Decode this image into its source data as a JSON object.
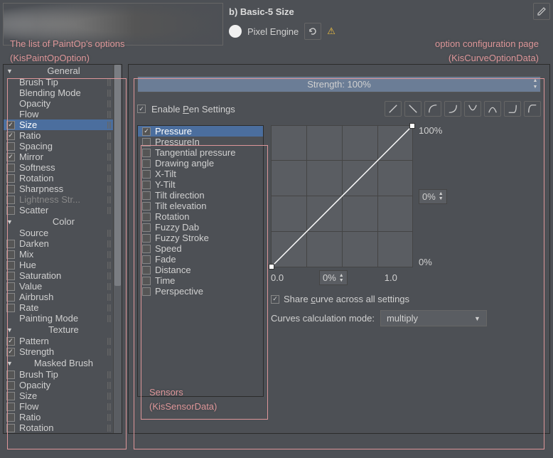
{
  "header": {
    "brush_name": "b) Basic-5 Size",
    "engine": "Pixel Engine",
    "edit_icon": "pencil-icon",
    "refresh_icon": "refresh-icon",
    "warn_icon": "warning-icon"
  },
  "annotations": {
    "left": "The list of PaintOp's options\n(KisPaintOpOption)",
    "right_top": "option configuration page",
    "right_bottom": "(KisCurveOptionData)",
    "sensors": "Sensors\n(KisSensorData)"
  },
  "options": {
    "categories": [
      {
        "name": "General",
        "items": [
          {
            "label": "Brush Tip",
            "checked": false,
            "nochk": true
          },
          {
            "label": "Blending Mode",
            "checked": false,
            "nochk": true
          },
          {
            "label": "Opacity",
            "checked": false,
            "nochk": true
          },
          {
            "label": "Flow",
            "checked": false,
            "nochk": true
          },
          {
            "label": "Size",
            "checked": true,
            "selected": true
          },
          {
            "label": "Ratio",
            "checked": true
          },
          {
            "label": "Spacing",
            "checked": false
          },
          {
            "label": "Mirror",
            "checked": true
          },
          {
            "label": "Softness",
            "checked": false
          },
          {
            "label": "Rotation",
            "checked": false
          },
          {
            "label": "Sharpness",
            "checked": false
          },
          {
            "label": "Lightness Str...",
            "checked": false,
            "disabled": true
          },
          {
            "label": "Scatter",
            "checked": false
          }
        ]
      },
      {
        "name": "Color",
        "items": [
          {
            "label": "Source",
            "checked": false,
            "nochk": true
          },
          {
            "label": "Darken",
            "checked": false
          },
          {
            "label": "Mix",
            "checked": false
          },
          {
            "label": "Hue",
            "checked": false
          },
          {
            "label": "Saturation",
            "checked": false
          },
          {
            "label": "Value",
            "checked": false
          },
          {
            "label": "Airbrush",
            "checked": false
          },
          {
            "label": "Rate",
            "checked": false
          },
          {
            "label": "Painting Mode",
            "checked": false,
            "nochk": true
          }
        ]
      },
      {
        "name": "Texture",
        "items": [
          {
            "label": "Pattern",
            "checked": true
          },
          {
            "label": "Strength",
            "checked": true
          }
        ]
      },
      {
        "name": "Masked Brush",
        "items": [
          {
            "label": "Brush Tip",
            "checked": false
          },
          {
            "label": "Opacity",
            "checked": false
          },
          {
            "label": "Size",
            "checked": false
          },
          {
            "label": "Flow",
            "checked": false
          },
          {
            "label": "Ratio",
            "checked": false
          },
          {
            "label": "Rotation",
            "checked": false
          }
        ]
      }
    ]
  },
  "config": {
    "strength_label": "Strength: 100%",
    "enable_pen": "Enable Pen Settings",
    "enable_pen_checked": true,
    "curve_presets": [
      "linear",
      "linear-down",
      "ease-in",
      "ease-out",
      "u-shape",
      "n-shape",
      "j-shape",
      "reverse-j"
    ],
    "sensors": [
      {
        "label": "Pressure",
        "checked": true,
        "selected": true
      },
      {
        "label": "PressureIn",
        "checked": false
      },
      {
        "label": "Tangential pressure",
        "checked": false
      },
      {
        "label": "Drawing angle",
        "checked": false
      },
      {
        "label": "X-Tilt",
        "checked": false
      },
      {
        "label": "Y-Tilt",
        "checked": false
      },
      {
        "label": "Tilt direction",
        "checked": false
      },
      {
        "label": "Tilt elevation",
        "checked": false
      },
      {
        "label": "Rotation",
        "checked": false
      },
      {
        "label": "Fuzzy Dab",
        "checked": false
      },
      {
        "label": "Fuzzy Stroke",
        "checked": false
      },
      {
        "label": "Speed",
        "checked": false
      },
      {
        "label": "Fade",
        "checked": false
      },
      {
        "label": "Distance",
        "checked": false
      },
      {
        "label": "Time",
        "checked": false
      },
      {
        "label": "Perspective",
        "checked": false
      }
    ],
    "y_max": "100%",
    "y_min": "0%",
    "y_field": "0%",
    "x_min": "0.0",
    "x_max": "1.0",
    "x_field": "0%",
    "share_label": "Share curve across all settings",
    "share_checked": true,
    "calc_label": "Curves calculation mode:",
    "calc_value": "multiply"
  }
}
